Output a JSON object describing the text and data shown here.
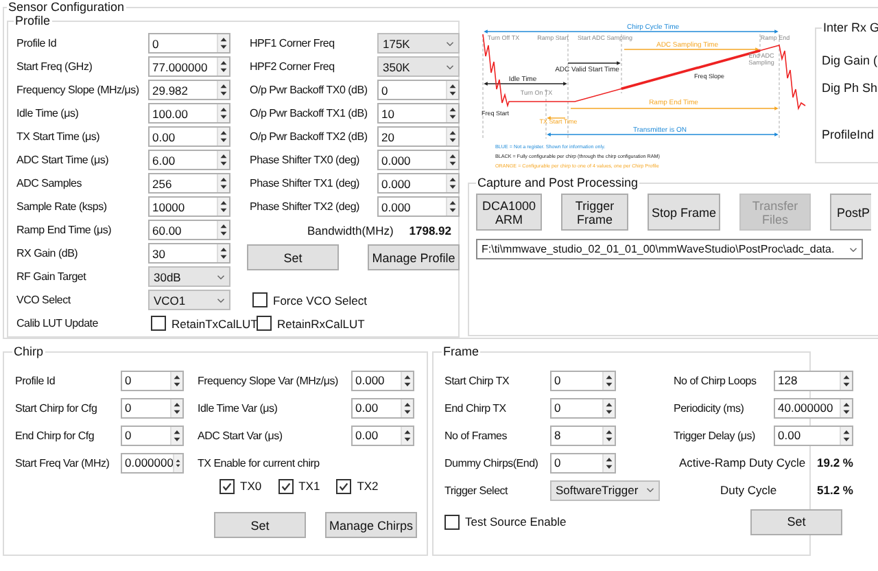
{
  "section_title": "Sensor Configuration",
  "profile": {
    "title": "Profile",
    "left": [
      {
        "label": "Profile Id",
        "value": "0",
        "kind": "spin"
      },
      {
        "label": "Start Freq (GHz)",
        "value": "77.000000",
        "kind": "spin"
      },
      {
        "label": "Frequency Slope (MHz/μs)",
        "value": "29.982",
        "kind": "spin"
      },
      {
        "label": "Idle Time (μs)",
        "value": "100.00",
        "kind": "spin"
      },
      {
        "label": "TX Start Time (μs)",
        "value": "0.00",
        "kind": "spin"
      },
      {
        "label": "ADC Start Time (μs)",
        "value": "6.00",
        "kind": "spin"
      },
      {
        "label": "ADC Samples",
        "value": "256",
        "kind": "spin"
      },
      {
        "label": "Sample Rate (ksps)",
        "value": "10000",
        "kind": "spin"
      },
      {
        "label": "Ramp End Time (μs)",
        "value": "60.00",
        "kind": "spin"
      },
      {
        "label": "RX Gain (dB)",
        "value": "30",
        "kind": "spin"
      },
      {
        "label": "RF Gain Target",
        "value": "30dB",
        "kind": "dropdown"
      },
      {
        "label": "VCO Select",
        "value": "VCO1",
        "kind": "dropdown"
      }
    ],
    "right": [
      {
        "label": "HPF1 Corner Freq",
        "value": "175K",
        "kind": "dropdown"
      },
      {
        "label": "HPF2 Corner Freq",
        "value": "350K",
        "kind": "dropdown"
      },
      {
        "label": "O/p Pwr Backoff TX0 (dB)",
        "value": "0",
        "kind": "spin"
      },
      {
        "label": "O/p Pwr Backoff TX1 (dB)",
        "value": "10",
        "kind": "spin"
      },
      {
        "label": "O/p Pwr Backoff TX2 (dB)",
        "value": "20",
        "kind": "spin"
      },
      {
        "label": "Phase Shifter TX0 (deg)",
        "value": "0.000",
        "kind": "spin"
      },
      {
        "label": "Phase Shifter TX1 (deg)",
        "value": "0.000",
        "kind": "spin"
      },
      {
        "label": "Phase Shifter TX2 (deg)",
        "value": "0.000",
        "kind": "spin"
      }
    ],
    "bandwidth_label": "Bandwidth(MHz)",
    "bandwidth_value": "1798.92",
    "buttons": [
      "Set",
      "Manage Profile"
    ],
    "force_vco": {
      "label": "Force VCO Select",
      "checked": false
    },
    "calib_label": "Calib LUT Update",
    "calib_options": [
      {
        "label": "RetainTxCalLUT",
        "checked": false
      },
      {
        "label": "RetainRxCalLUT",
        "checked": false
      }
    ]
  },
  "diagram": {
    "labels": [
      {
        "text": "Chirp Cycle Time",
        "kind": "blue"
      },
      {
        "text": "Turn Off TX",
        "kind": "gray"
      },
      {
        "text": "Ramp Start",
        "kind": "gray"
      },
      {
        "text": "Start ADC Sampling",
        "kind": "gray"
      },
      {
        "text": "ADC Sampling Time",
        "kind": "orange"
      },
      {
        "text": "Ramp End",
        "kind": "gray"
      },
      {
        "text": "End ADC\nSampling",
        "kind": "gray"
      },
      {
        "text": "ADC Valid Start Time",
        "kind": "black"
      },
      {
        "text": "Freq Slope",
        "kind": "black"
      },
      {
        "text": "Idle Time",
        "kind": "black"
      },
      {
        "text": "Turn On TX",
        "kind": "gray"
      },
      {
        "text": "Freq Start",
        "kind": "black"
      },
      {
        "text": "Ramp End Time",
        "kind": "orange"
      },
      {
        "text": "TX Start Time",
        "kind": "orange"
      },
      {
        "text": "Transmitter is ON",
        "kind": "blue"
      },
      {
        "text": "BLUE = Not a register. Shown for information only.",
        "kind": "blue"
      },
      {
        "text": "BLACK = Fully configurable per chirp (through the chirp configuration RAM)",
        "kind": "black"
      },
      {
        "text": "ORANGE = Configurable per chirp to one of 4 values, one per Chirp Profile",
        "kind": "orange"
      }
    ]
  },
  "inter_rx": {
    "title": "Inter Rx G",
    "labels": [
      "Dig Gain (",
      "Dig Ph Sh",
      "ProfileInd"
    ]
  },
  "capture": {
    "title": "Capture and Post Processing",
    "buttons": [
      {
        "label": "DCA1000\nARM",
        "disabled": false
      },
      {
        "label": "Trigger\nFrame",
        "disabled": false
      },
      {
        "label": "Stop Frame",
        "disabled": false
      },
      {
        "label": "Transfer\nFiles",
        "disabled": true
      },
      {
        "label": "PostP",
        "disabled": false
      }
    ],
    "path": "F:\\ti\\mmwave_studio_02_01_01_00\\mmWaveStudio\\PostProc\\adc_data."
  },
  "chirp": {
    "title": "Chirp",
    "left": [
      {
        "label": "Profile Id",
        "value": "0"
      },
      {
        "label": "Start Chirp for Cfg",
        "value": "0"
      },
      {
        "label": "End Chirp for Cfg",
        "value": "0"
      },
      {
        "label": "Start Freq Var (MHz)",
        "value": "0.000000"
      }
    ],
    "right": [
      {
        "label": "Frequency Slope Var (MHz/μs)",
        "value": "0.000"
      },
      {
        "label": "Idle Time Var (μs)",
        "value": "0.00"
      },
      {
        "label": "ADC Start Var (μs)",
        "value": "0.00"
      }
    ],
    "tx_label": "TX Enable for current chirp",
    "tx": [
      {
        "label": "TX0",
        "checked": true
      },
      {
        "label": "TX1",
        "checked": true
      },
      {
        "label": "TX2",
        "checked": true
      }
    ],
    "buttons": [
      "Set",
      "Manage Chirps"
    ]
  },
  "frame": {
    "title": "Frame",
    "left": [
      {
        "label": "Start Chirp TX",
        "value": "0"
      },
      {
        "label": "End Chirp TX",
        "value": "0"
      },
      {
        "label": "No of Frames",
        "value": "8"
      },
      {
        "label": "Dummy Chirps(End)",
        "value": "0"
      }
    ],
    "right": [
      {
        "label": "No of Chirp Loops",
        "value": "128"
      },
      {
        "label": "Periodicity (ms)",
        "value": "40.000000"
      },
      {
        "label": "Trigger Delay (μs)",
        "value": "0.00"
      }
    ],
    "active_ramp_label": "Active-Ramp Duty Cycle",
    "active_ramp_value": "19.2 %",
    "duty_label": "Duty Cycle",
    "duty_value": "51.2 %",
    "trigger": {
      "label": "Trigger Select",
      "value": "SoftwareTrigger"
    },
    "test_source": {
      "label": "Test Source Enable",
      "checked": false
    },
    "button": "Set"
  }
}
